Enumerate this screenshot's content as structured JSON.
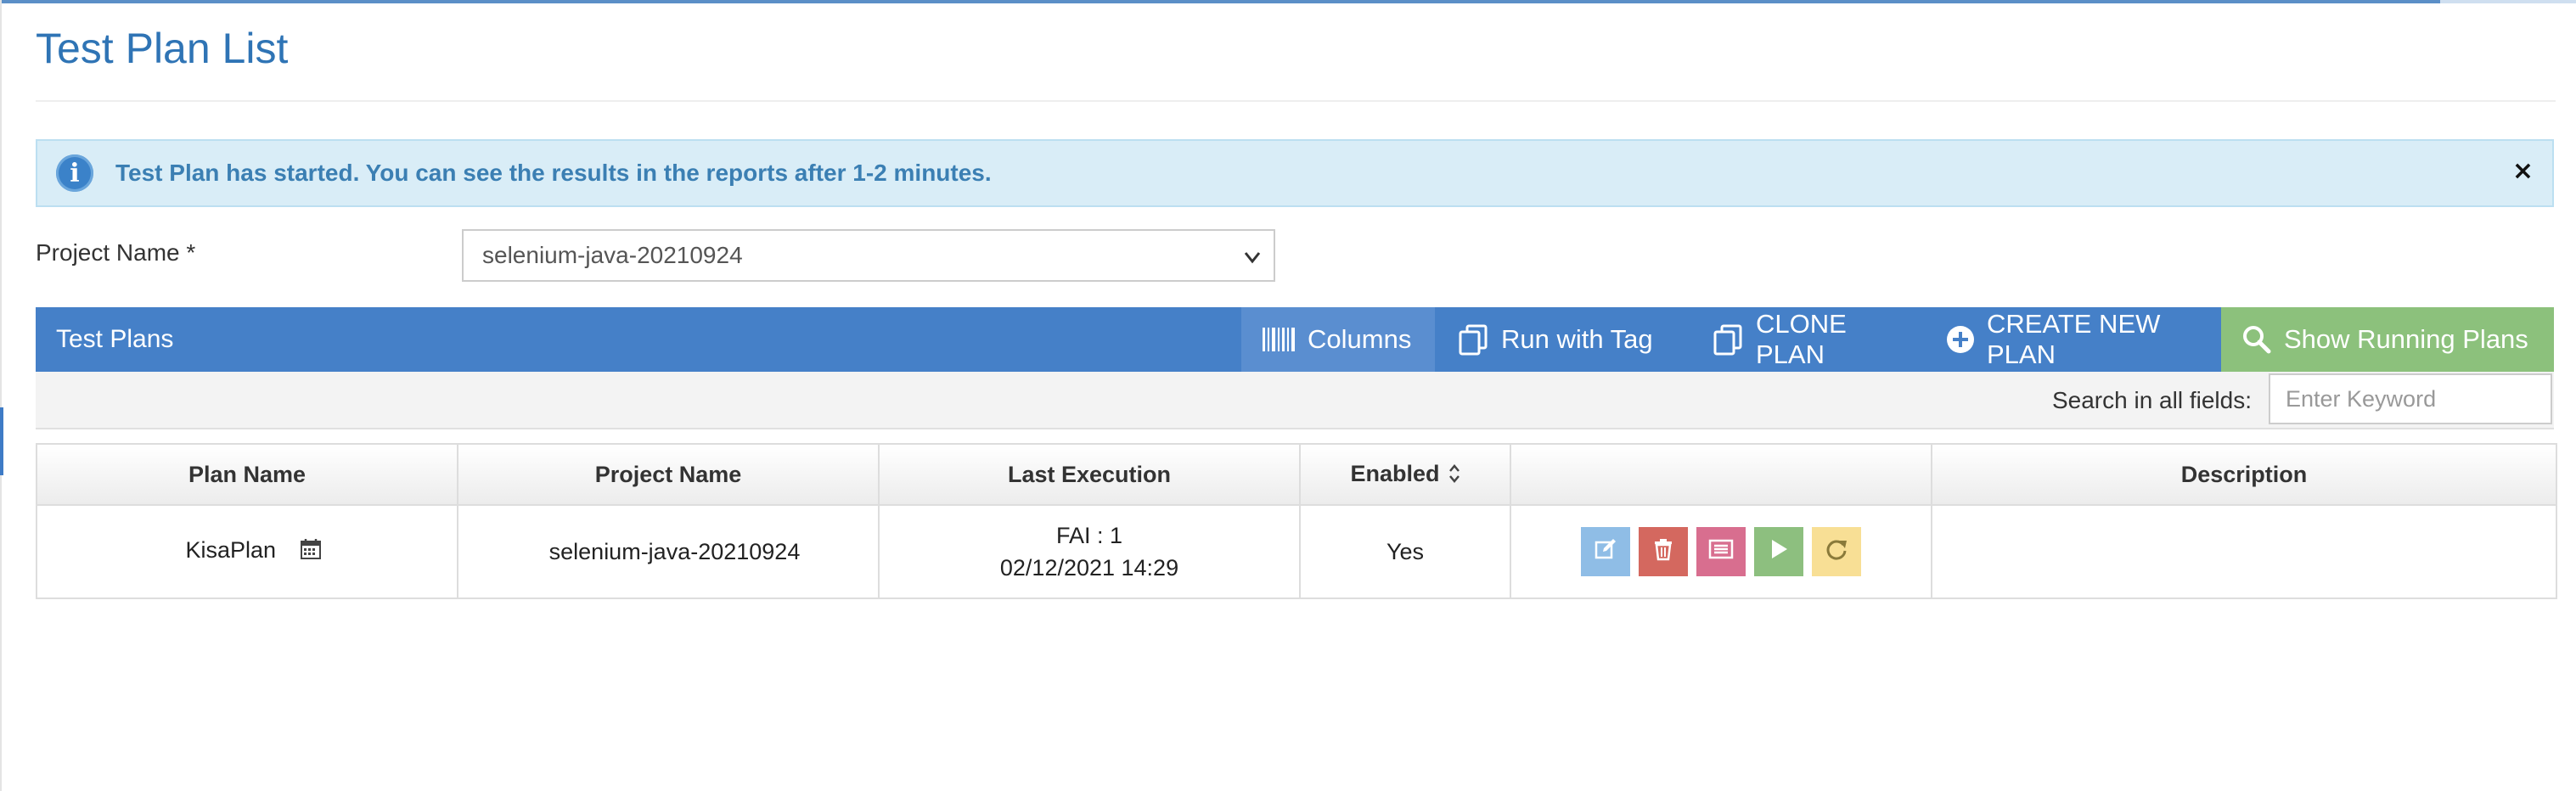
{
  "page": {
    "title": "Test Plan List"
  },
  "alert": {
    "message": "Test Plan has started. You can see the results in the reports after 1-2 minutes.",
    "close": "×"
  },
  "project": {
    "label": "Project Name *",
    "selected": "selenium-java-20210924"
  },
  "toolbar": {
    "title": "Test Plans",
    "columns_label": "Columns",
    "run_with_tag_label": "Run with Tag",
    "clone_plan_label": "CLONE PLAN",
    "create_new_plan_label": "CREATE NEW PLAN",
    "show_running_plans_label": "Show Running Plans"
  },
  "search": {
    "label": "Search in all fields:",
    "placeholder": "Enter Keyword"
  },
  "table": {
    "headers": {
      "plan_name": "Plan Name",
      "project_name": "Project Name",
      "last_execution": "Last Execution",
      "enabled": "Enabled",
      "actions": "",
      "description": "Description"
    },
    "rows": [
      {
        "plan_name": "KisaPlan",
        "project_name": "selenium-java-20210924",
        "last_execution_line1": "FAI : 1",
        "last_execution_line2": "02/12/2021 14:29",
        "enabled": "Yes",
        "description": ""
      }
    ]
  },
  "icons": {
    "alert": "info-circle-icon",
    "columns": "barcode-columns-icon",
    "run_with_tag": "copy-icon",
    "clone": "copy-icon",
    "create": "plus-circle-icon",
    "show_running": "search-icon",
    "row_actions": [
      "edit-icon",
      "trash-icon",
      "report-icon",
      "play-icon",
      "refresh-icon"
    ]
  },
  "colors": {
    "title": "#2f74b5",
    "toolbar": "#4580c8",
    "columns_button": "#5a8ed0",
    "show_running_button": "#8cc17c",
    "alert_bg": "#d9edf7",
    "alert_text": "#3b7fb3",
    "action_edit": "#8fbde6",
    "action_delete": "#d4685f",
    "action_report": "#d86e8f",
    "action_run": "#8dbf7f",
    "action_rerun": "#f8df95"
  }
}
